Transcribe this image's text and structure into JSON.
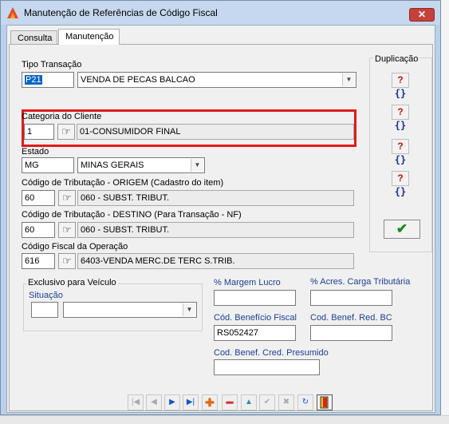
{
  "window": {
    "title": "Manutenção de Referências de Código Fiscal",
    "close_label": "✕"
  },
  "tabs": [
    {
      "label": "Consulta",
      "active": false
    },
    {
      "label": "Manutenção",
      "active": true
    }
  ],
  "fields": {
    "tipo_transacao": {
      "label": "Tipo Transação",
      "code": "P21",
      "value": "VENDA DE PECAS BALCAO"
    },
    "categoria_cliente": {
      "label": "Categoria do Cliente",
      "code": "1",
      "value": "01-CONSUMIDOR FINAL"
    },
    "estado": {
      "label": "Estado",
      "code": "MG",
      "value": "MINAS GERAIS"
    },
    "trib_origem": {
      "label": "Código de Tributação - ORIGEM (Cadastro do item)",
      "code": "60",
      "value": "060 - SUBST. TRIBUT."
    },
    "trib_destino": {
      "label": "Código de Tributação - DESTINO (Para Transação - NF)",
      "code": "60",
      "value": "060 - SUBST. TRIBUT."
    },
    "cfop": {
      "label": "Código Fiscal da Operação",
      "code": "616",
      "value": "6403-VENDA MERC.DE TERC S.TRIB."
    }
  },
  "veiculo": {
    "caption": "Exclusivo para Veículo",
    "situacao_label": "Situação",
    "situacao_code": "",
    "situacao_value": ""
  },
  "fiscal": {
    "margem_lucro_label": "% Margem Lucro",
    "margem_lucro": "",
    "acres_carga_label": "% Acres. Carga Tributária",
    "acres_carga": "",
    "beneficio_fiscal_label": "Cód. Benefício Fiscal",
    "beneficio_fiscal": "RS052427",
    "benef_red_bc_label": "Cod. Benef. Red. BC",
    "benef_red_bc": "",
    "benef_cred_pres_label": "Cod. Benef. Cred. Presumido",
    "benef_cred_pres": ""
  },
  "duplicacao": {
    "caption": "Duplicação",
    "button_glyph_q": "?",
    "button_glyph_b": "{}",
    "confirm_glyph": "✔"
  },
  "toolbar": {
    "first": "|◀",
    "prev": "◀",
    "next": "▶",
    "last": "▶|",
    "add": "✚",
    "remove": "━",
    "up": "▲",
    "confirm": "✔",
    "cancel": "✖",
    "refresh": "↻",
    "exit": "▮"
  }
}
